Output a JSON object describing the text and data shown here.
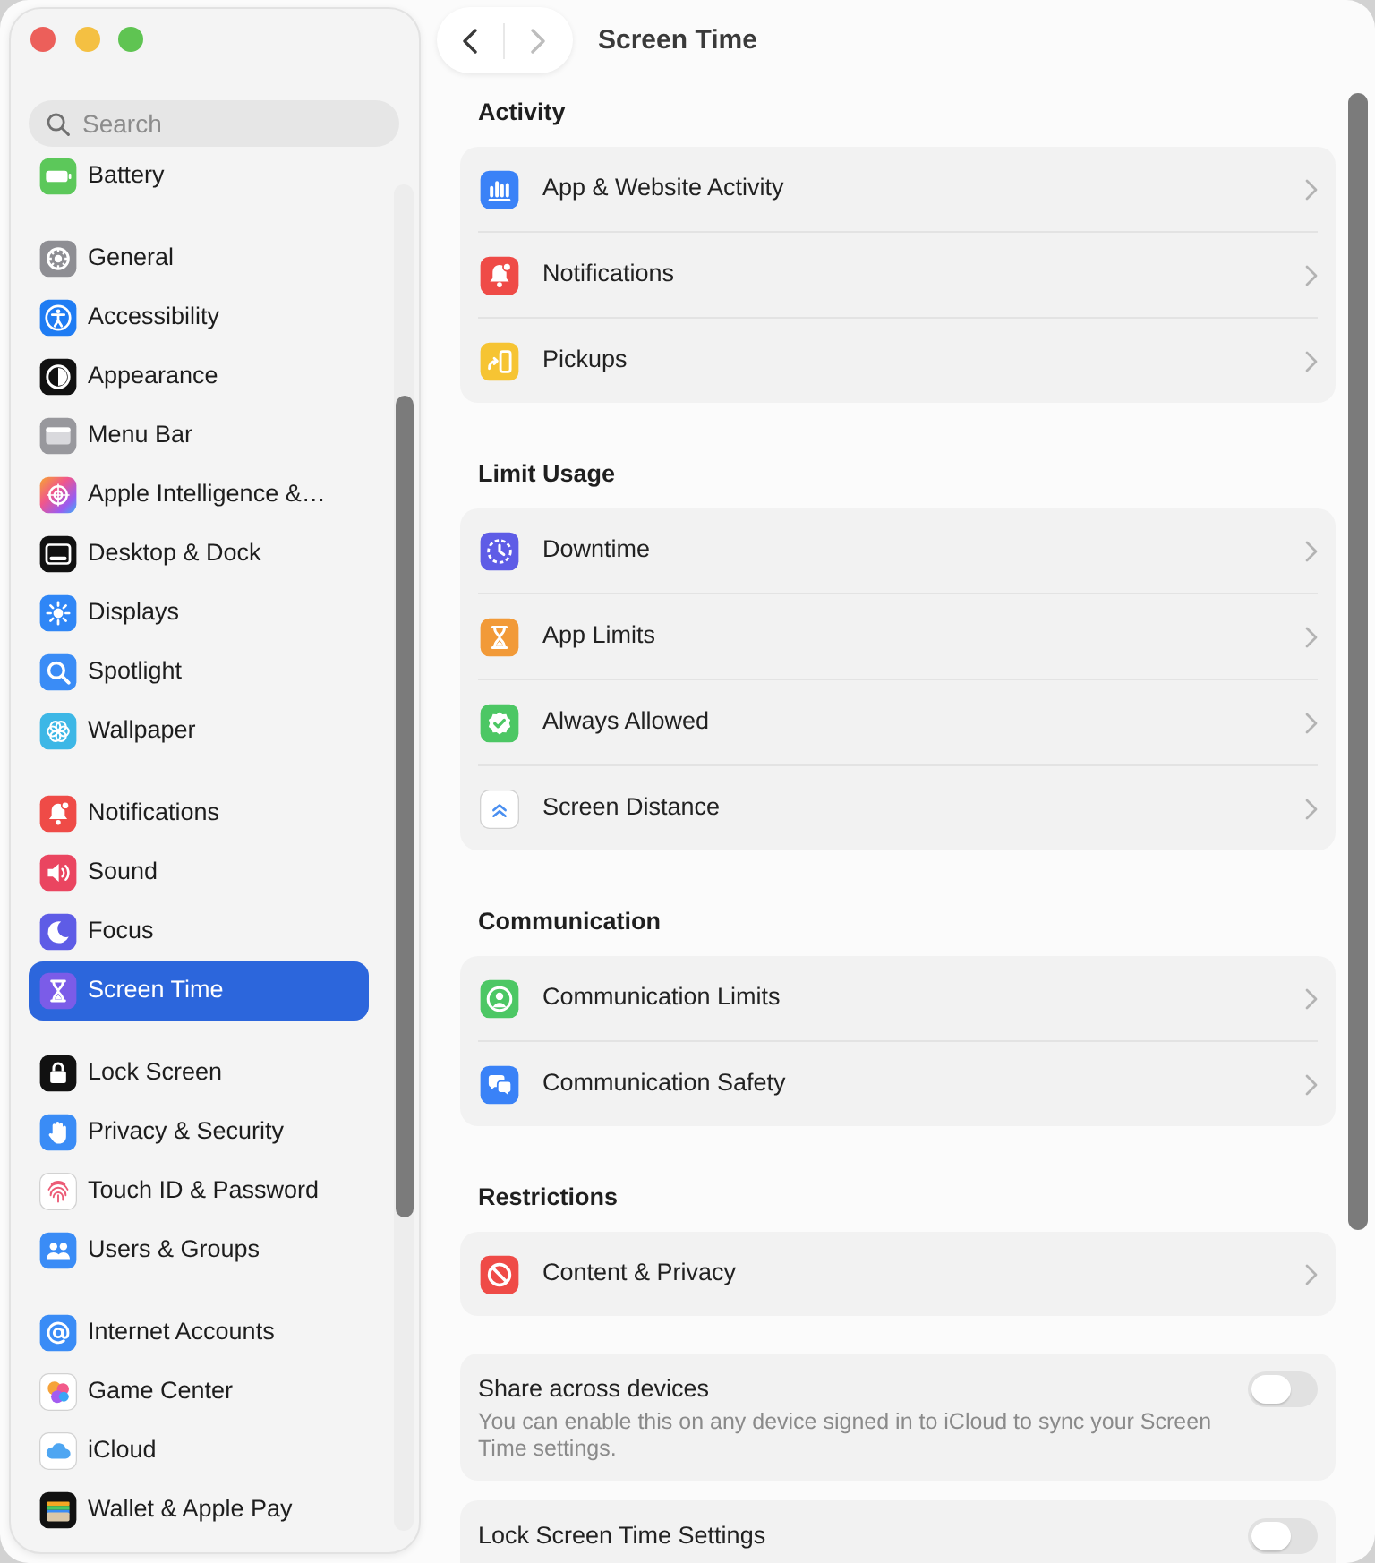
{
  "window": {
    "controls": [
      {
        "color": "#ec5f5a"
      },
      {
        "color": "#f4c042"
      },
      {
        "color": "#5fc452"
      }
    ]
  },
  "sidebar": {
    "search": {
      "placeholder": "Search"
    },
    "groups": [
      {
        "items": [
          {
            "label": "Battery",
            "selected": false
          }
        ]
      },
      {
        "items": [
          {
            "label": "General",
            "selected": false
          },
          {
            "label": "Accessibility",
            "selected": false
          },
          {
            "label": "Appearance",
            "selected": false
          },
          {
            "label": "Menu Bar",
            "selected": false
          },
          {
            "label": "Apple Intelligence &…",
            "selected": false
          },
          {
            "label": "Desktop & Dock",
            "selected": false
          },
          {
            "label": "Displays",
            "selected": false
          },
          {
            "label": "Spotlight",
            "selected": false
          },
          {
            "label": "Wallpaper",
            "selected": false
          }
        ]
      },
      {
        "items": [
          {
            "label": "Notifications",
            "selected": false
          },
          {
            "label": "Sound",
            "selected": false
          },
          {
            "label": "Focus",
            "selected": false
          },
          {
            "label": "Screen Time",
            "selected": true
          }
        ]
      },
      {
        "items": [
          {
            "label": "Lock Screen",
            "selected": false
          },
          {
            "label": "Privacy & Security",
            "selected": false
          },
          {
            "label": "Touch ID & Password",
            "selected": false
          },
          {
            "label": "Users & Groups",
            "selected": false
          }
        ]
      },
      {
        "items": [
          {
            "label": "Internet Accounts",
            "selected": false
          },
          {
            "label": "Game Center",
            "selected": false
          },
          {
            "label": "iCloud",
            "selected": false
          },
          {
            "label": "Wallet & Apple Pay",
            "selected": false
          }
        ]
      }
    ]
  },
  "toolbar": {
    "nav": [
      {
        "kind": "back",
        "disabled": false
      },
      {
        "kind": "forward",
        "disabled": true
      }
    ],
    "title": "Screen Time"
  },
  "sections": [
    {
      "title": "Activity",
      "rows": [
        {
          "label": "App & Website Activity"
        },
        {
          "label": "Notifications"
        },
        {
          "label": "Pickups"
        }
      ]
    },
    {
      "title": "Limit Usage",
      "rows": [
        {
          "label": "Downtime"
        },
        {
          "label": "App Limits"
        },
        {
          "label": "Always Allowed"
        },
        {
          "label": "Screen Distance"
        }
      ]
    },
    {
      "title": "Communication",
      "rows": [
        {
          "label": "Communication Limits"
        },
        {
          "label": "Communication Safety"
        }
      ]
    },
    {
      "title": "Restrictions",
      "rows": [
        {
          "label": "Content & Privacy"
        }
      ]
    }
  ],
  "toggles": [
    {
      "title": "Share across devices",
      "description": "You can enable this on any device signed in to iCloud to sync your Screen Time settings.",
      "on": false
    },
    {
      "title": "Lock Screen Time Settings",
      "on": false
    }
  ]
}
